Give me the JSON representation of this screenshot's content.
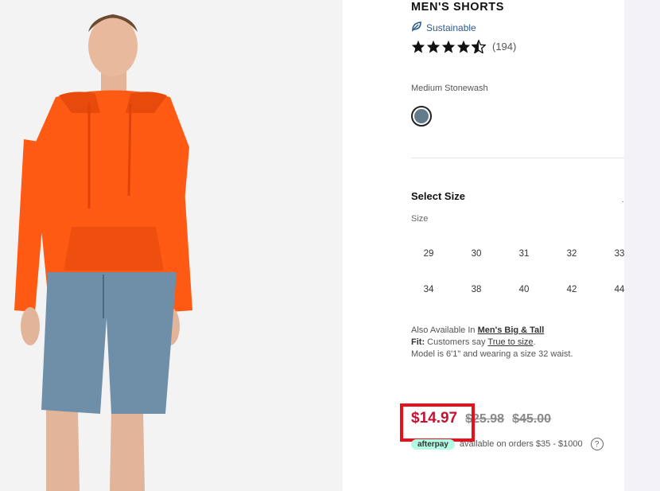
{
  "product": {
    "title": "MEN'S SHORTS",
    "sustainable_label": "Sustainable",
    "rating_count": "(194)",
    "rating_value": 4.5,
    "color_name": "Medium Stonewash",
    "swatch_color": "#647b8c"
  },
  "size": {
    "title": "Select Size",
    "label": "Size",
    "options": [
      "29",
      "30",
      "31",
      "32",
      "33",
      "34",
      "38",
      "40",
      "42",
      "44"
    ]
  },
  "info": {
    "also_available_prefix": "Also Available In",
    "also_available_link": "Men's Big & Tall",
    "fit_label": "Fit:",
    "fit_text": "Customers say",
    "fit_link": "True to size",
    "fit_suffix": ".",
    "model_text": "Model is 6'1\" and wearing a size 32 waist."
  },
  "price": {
    "sale": "$14.97",
    "previous": "$25.98",
    "original": "$45.00"
  },
  "afterpay": {
    "badge": "afterpay",
    "text": "available on orders $35 - $1000",
    "help": "?"
  },
  "colors": {
    "sale_red": "#c41230",
    "highlight_red": "#e8101a",
    "hoodie_orange": "#ff5a14",
    "denim": "#6f8fa8"
  },
  "icons": [
    "leaf-icon",
    "star-icon",
    "help-icon"
  ]
}
